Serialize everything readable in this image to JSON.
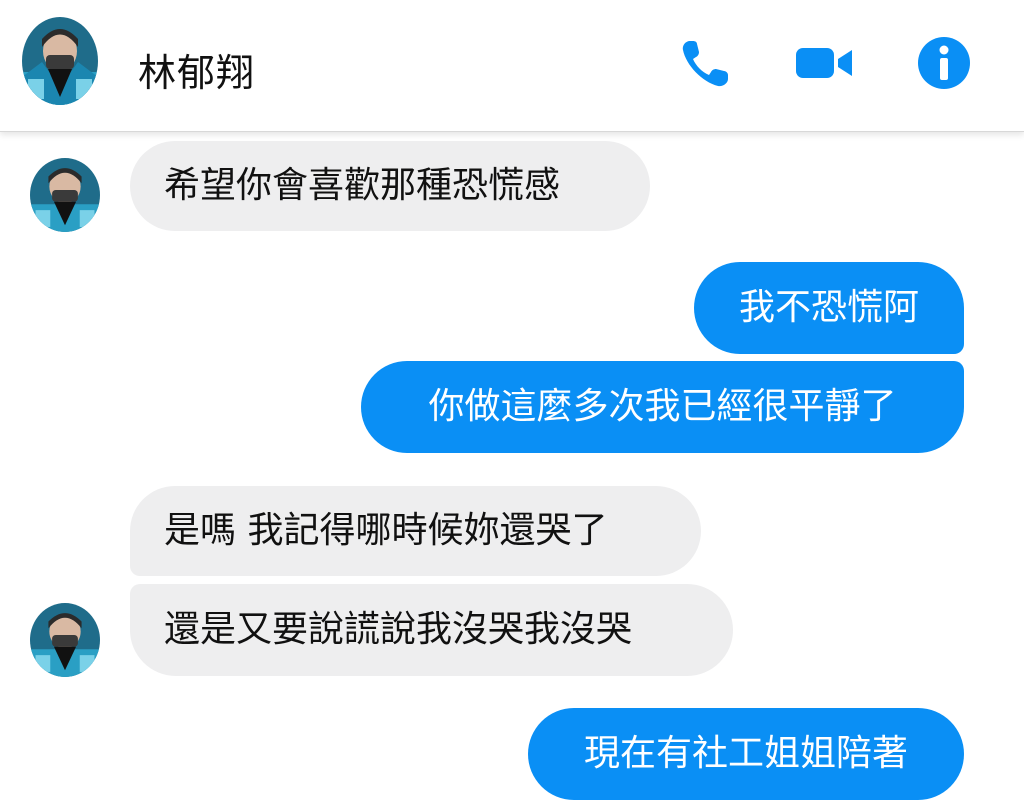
{
  "header": {
    "contact_name": "林郁翔",
    "icons": [
      "phone-icon",
      "video-camera-icon",
      "info-icon"
    ],
    "accent_color": "#0a8ff5"
  },
  "messages": [
    {
      "direction": "incoming",
      "text": "希望你會喜歡那種恐慌感"
    },
    {
      "direction": "outgoing",
      "text": "我不恐慌阿"
    },
    {
      "direction": "outgoing",
      "text": "你做這麼多次我已經很平靜了"
    },
    {
      "direction": "incoming",
      "text": "是嗎 我記得哪時候妳還哭了"
    },
    {
      "direction": "incoming",
      "text": "還是又要說謊說我沒哭我沒哭"
    },
    {
      "direction": "outgoing",
      "text": "現在有社工姐姐陪著"
    }
  ],
  "colors": {
    "incoming_bubble": "#eeeeef",
    "outgoing_bubble": "#0a8ff5",
    "outgoing_text": "#ffffff"
  }
}
